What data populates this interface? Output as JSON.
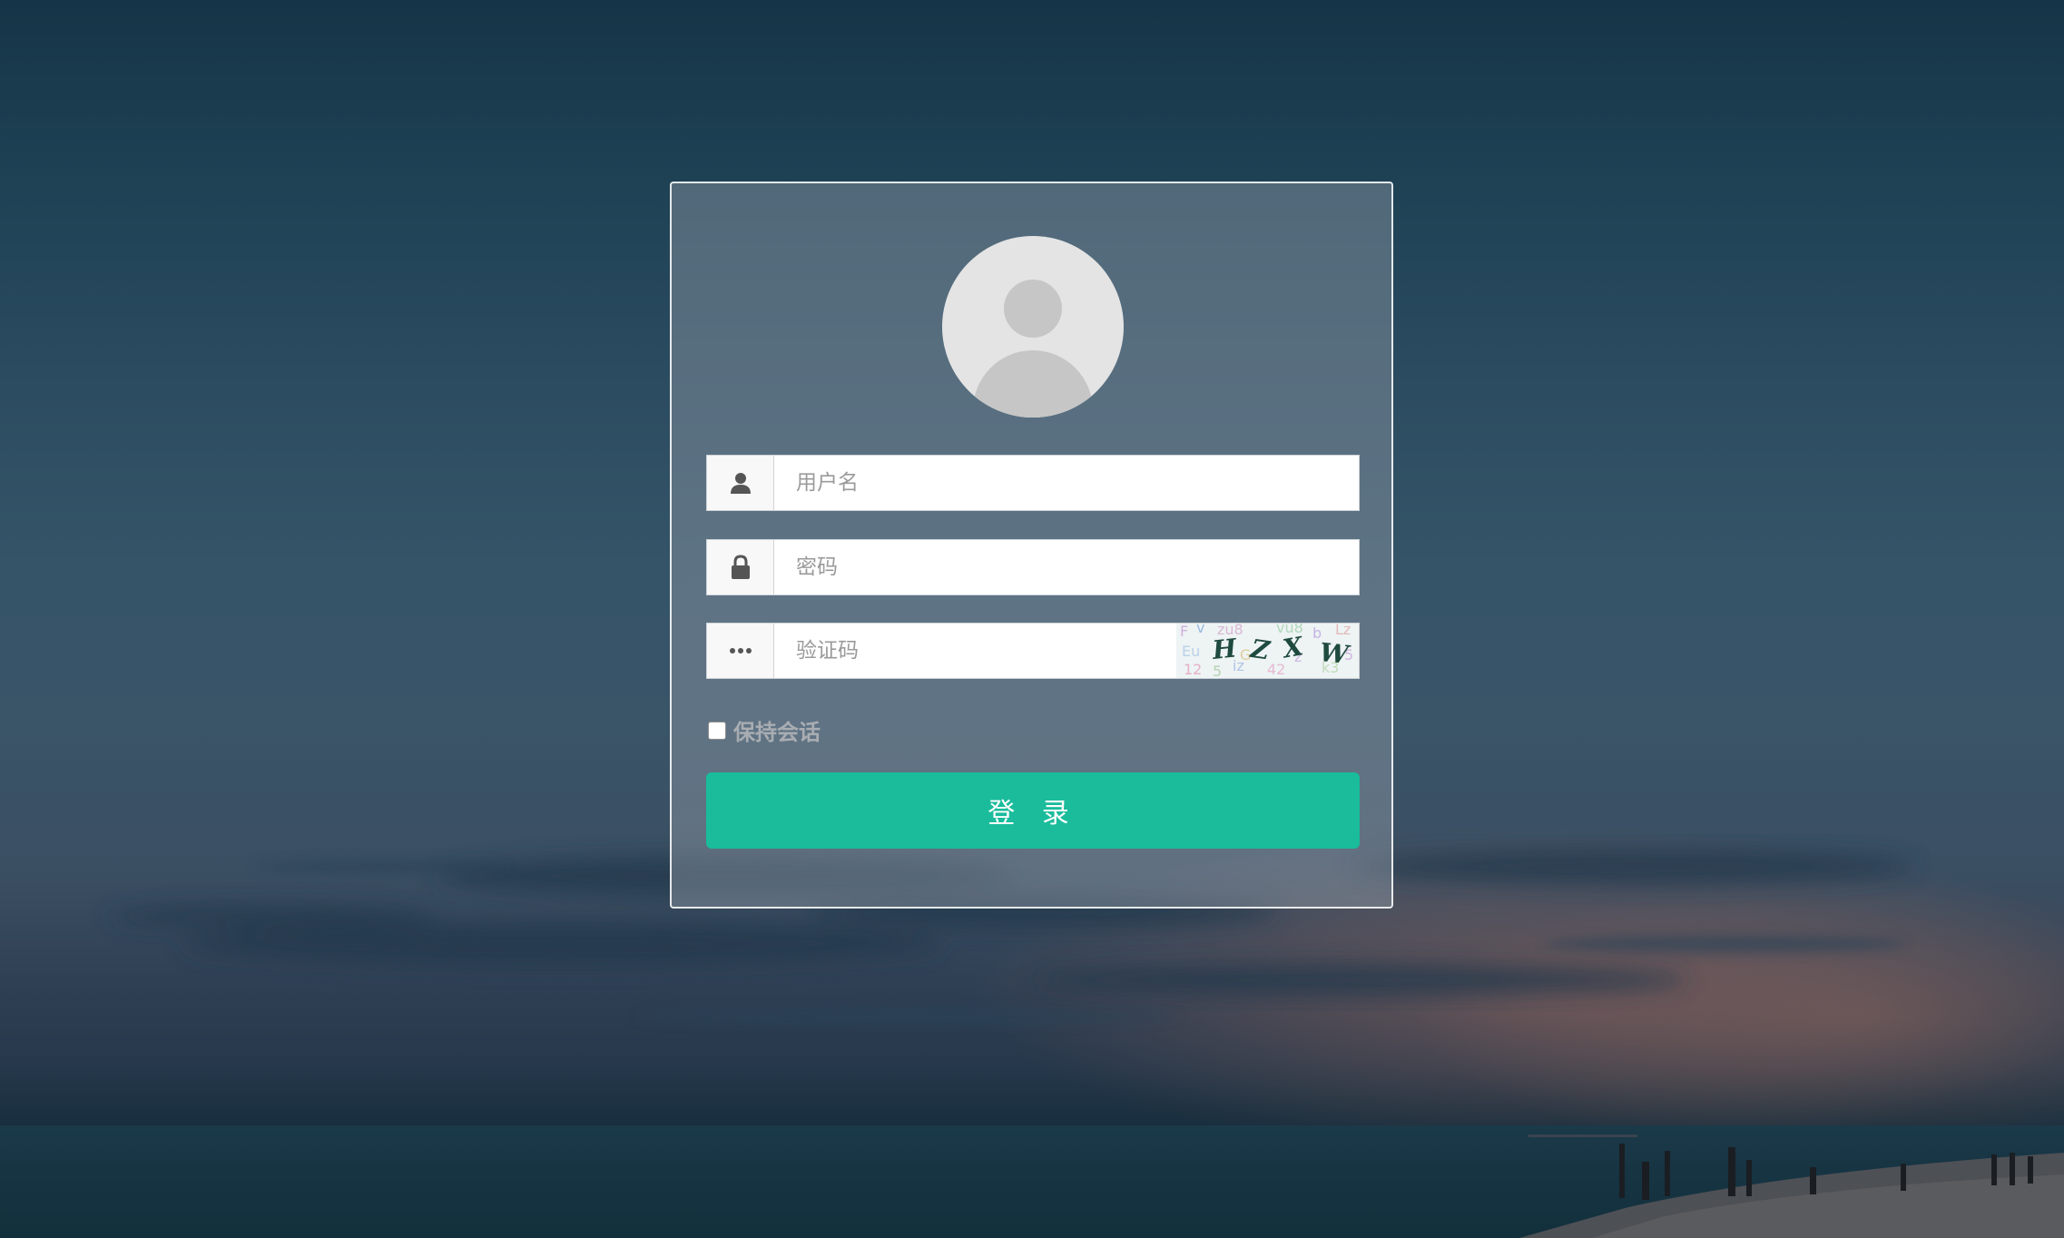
{
  "login_form": {
    "username": {
      "placeholder": "用户名",
      "value": "",
      "icon": "user-icon"
    },
    "password": {
      "placeholder": "密码",
      "value": "",
      "icon": "lock-icon"
    },
    "captcha": {
      "placeholder": "验证码",
      "value": "",
      "icon": "ellipsis-icon",
      "image_text": "HZXW"
    },
    "remember_label": "保持会话",
    "remember_checked": false,
    "submit_label": "登 录"
  },
  "colors": {
    "accent": "#1abc9c",
    "card_border": "#ffffff",
    "placeholder": "#9a9a9a"
  }
}
